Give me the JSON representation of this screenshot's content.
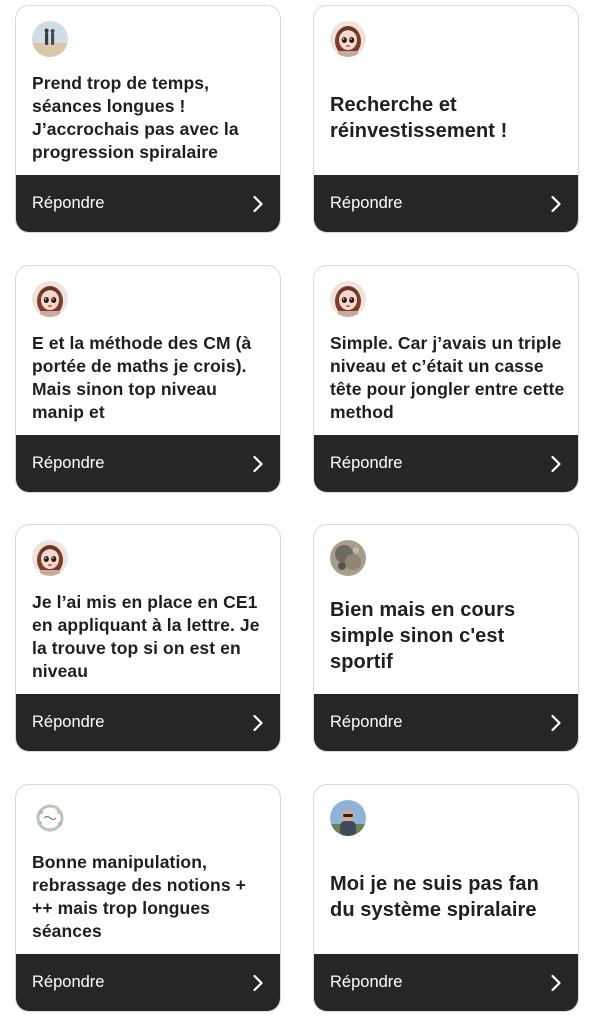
{
  "reply_label": "Répondre",
  "cards": [
    {
      "text": "Prend trop de temps, séances longues ! J’accrochais pas avec la progression spiralaire",
      "avatar": "couple-beach-avatar"
    },
    {
      "text": "Recherche et réinvestissement !",
      "avatar": "doll-girl-avatar"
    },
    {
      "text": "E et la méthode des CM (à portée de maths je crois). Mais sinon top niveau manip et",
      "avatar": "doll-girl-avatar"
    },
    {
      "text": "Simple. Car j’avais un triple niveau et c’était un casse tête pour jongler entre cette method",
      "avatar": "doll-girl-avatar"
    },
    {
      "text": "Je l’ai mis en place en CE1 en appliquant à la lettre. Je la trouve top si on est en niveau",
      "avatar": "doll-girl-avatar"
    },
    {
      "text": "Bien mais en cours simple sinon c'est sportif",
      "avatar": "stone-photo-avatar"
    },
    {
      "text": "Bonne manipulation, rebrassage des notions + ++ mais trop longues séances",
      "avatar": "floral-wreath-avatar"
    },
    {
      "text": "Moi je ne suis pas fan du système spiralaire",
      "avatar": "person-outdoor-avatar"
    }
  ]
}
